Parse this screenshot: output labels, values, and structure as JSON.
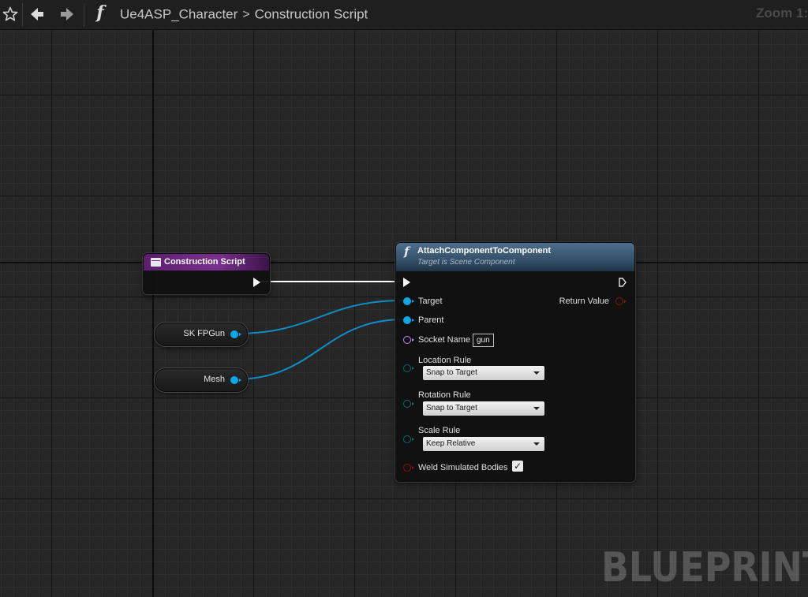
{
  "toolbar": {
    "favorite_icon": "star-outline-icon",
    "back_icon": "arrow-left-icon",
    "forward_icon": "arrow-right-icon",
    "function_icon": "f",
    "breadcrumb_blueprint": "Ue4ASP_Character",
    "breadcrumb_separator": ">",
    "breadcrumb_graph": "Construction Script",
    "zoom_label": "Zoom 1:"
  },
  "watermark": "BLUEPRINT",
  "nodes": {
    "construction_script": {
      "title": "Construction Script",
      "header_color": "#7a2f8f"
    },
    "variables": [
      {
        "label": "SK FPGun"
      },
      {
        "label": "Mesh"
      }
    ],
    "attach": {
      "icon": "f",
      "title": "AttachComponentToComponent",
      "subtitle": "Target is Scene Component",
      "header_color": "#3f5f7c",
      "pins": {
        "target": "Target",
        "parent": "Parent",
        "socket_name": "Socket Name",
        "socket_value": "gun",
        "return_value": "Return Value",
        "location_rule": "Location Rule",
        "location_value": "Snap to Target",
        "rotation_rule": "Rotation Rule",
        "rotation_value": "Snap to Target",
        "scale_rule": "Scale Rule",
        "scale_value": "Keep Relative",
        "weld": "Weld Simulated Bodies",
        "weld_checked": "✓"
      }
    }
  },
  "colors": {
    "object_pin": "#0aa6e8",
    "name_pin": "#c58cf0",
    "enum_pin": "#0c6b6b",
    "bool_pin": "#8b0f0f",
    "exec_wire": "#ffffff"
  }
}
